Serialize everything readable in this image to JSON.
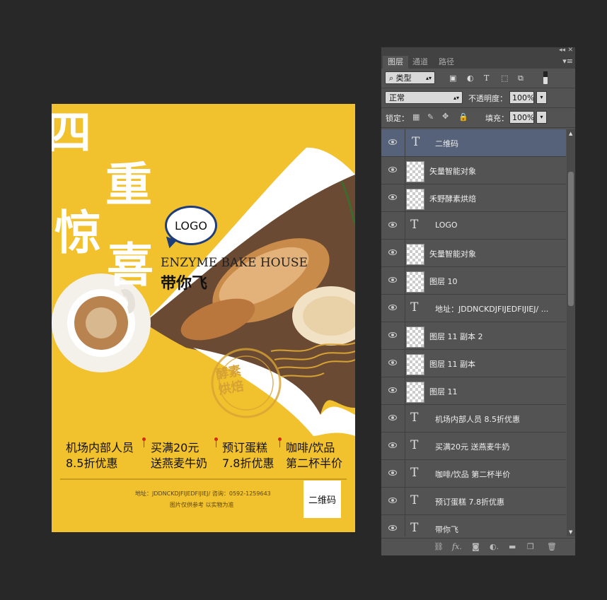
{
  "poster": {
    "title_chars": [
      "四",
      "重",
      "惊",
      "喜"
    ],
    "logo": "LOGO",
    "brand_en": "ENZYME BAKE HOUSE",
    "brand_cn": "带你飞",
    "stamp": [
      "酵素",
      "烘焙"
    ],
    "promos": [
      {
        "line1": "机场内部人员",
        "line2": "8.5折优惠"
      },
      {
        "line1": "买满20元",
        "line2": "送燕麦牛奶"
      },
      {
        "line1": "预订蛋糕",
        "line2": "7.8折优惠"
      },
      {
        "line1": "咖啡/饮品",
        "line2": "第二杯半价"
      }
    ],
    "address": "地址：JDDNCKDJFIJEDFIJIEJ/ 咨询：0592-1259643",
    "note": "图片仅供参考 以实物为准",
    "qr_label": "二维码",
    "colors": {
      "background": "#f2c12e",
      "pin": "#d42a1c"
    }
  },
  "panel": {
    "tabs": [
      "图层",
      "通道",
      "路径"
    ],
    "filter_type": "类型",
    "blend_mode": "正常",
    "opacity_label": "不透明度：",
    "opacity_value": "100%",
    "lock_label": "锁定：",
    "fill_label": "填充：",
    "fill_value": "100%",
    "layers": [
      {
        "name": "二维码",
        "kind": "text",
        "selected": true
      },
      {
        "name": "矢量智能对象",
        "kind": "smart"
      },
      {
        "name": "禾野酵素烘焙",
        "kind": "smart"
      },
      {
        "name": "LOGO",
        "kind": "text"
      },
      {
        "name": "矢量智能对象",
        "kind": "smart"
      },
      {
        "name": "图层 10",
        "kind": "raster"
      },
      {
        "name": "地址：JDDNCKDJFIJEDFIJIEJ/ ...",
        "kind": "text"
      },
      {
        "name": "图层 11 副本 2",
        "kind": "raster"
      },
      {
        "name": "图层 11 副本",
        "kind": "raster"
      },
      {
        "name": "图层 11",
        "kind": "raster"
      },
      {
        "name": "机场内部人员 8.5折优惠",
        "kind": "text"
      },
      {
        "name": "买满20元 送燕麦牛奶",
        "kind": "text"
      },
      {
        "name": "咖啡/饮品 第二杯半价",
        "kind": "text"
      },
      {
        "name": "预订蛋糕 7.8折优惠",
        "kind": "text"
      },
      {
        "name": "带你飞",
        "kind": "text"
      }
    ],
    "bottom_icons": [
      "link-icon",
      "fx-icon",
      "mask-icon",
      "adjustment-icon",
      "folder-icon",
      "new-layer-icon",
      "trash-icon"
    ]
  }
}
